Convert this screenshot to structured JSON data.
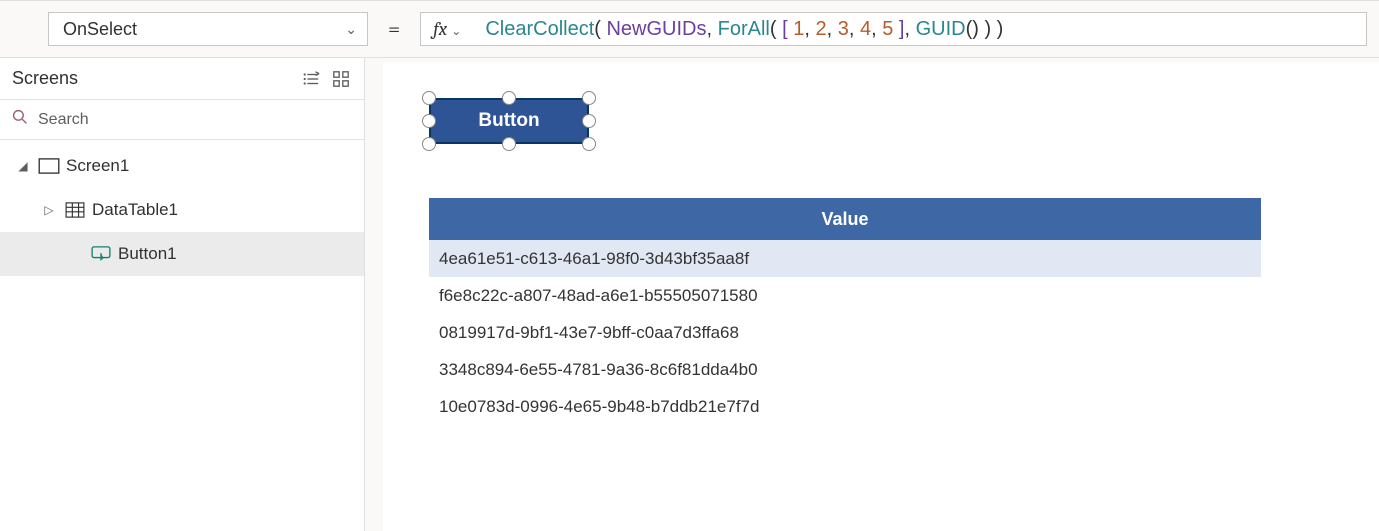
{
  "topbar": {
    "property": "OnSelect",
    "formula_tokens": [
      {
        "t": "ClearCollect",
        "c": "t-func"
      },
      {
        "t": "( ",
        "c": "t-punct"
      },
      {
        "t": "NewGUIDs",
        "c": "t-ident"
      },
      {
        "t": ", ",
        "c": "t-punct"
      },
      {
        "t": "ForAll",
        "c": "t-func"
      },
      {
        "t": "( ",
        "c": "t-punct"
      },
      {
        "t": "[ ",
        "c": "t-bracket"
      },
      {
        "t": "1",
        "c": "t-num"
      },
      {
        "t": ", ",
        "c": "t-punct"
      },
      {
        "t": "2",
        "c": "t-num"
      },
      {
        "t": ", ",
        "c": "t-punct"
      },
      {
        "t": "3",
        "c": "t-num"
      },
      {
        "t": ", ",
        "c": "t-punct"
      },
      {
        "t": "4",
        "c": "t-num"
      },
      {
        "t": ", ",
        "c": "t-punct"
      },
      {
        "t": "5",
        "c": "t-num"
      },
      {
        "t": " ]",
        "c": "t-bracket"
      },
      {
        "t": ", ",
        "c": "t-punct"
      },
      {
        "t": "GUID",
        "c": "t-func"
      },
      {
        "t": "() ) )",
        "c": "t-punct"
      }
    ]
  },
  "panel": {
    "title": "Screens",
    "search_placeholder": "Search",
    "tree": {
      "screen": "Screen1",
      "datatable": "DataTable1",
      "button": "Button1"
    }
  },
  "canvas": {
    "button_text": "Button",
    "table": {
      "header": "Value",
      "rows": [
        "4ea61e51-c613-46a1-98f0-3d43bf35aa8f",
        "f6e8c22c-a807-48ad-a6e1-b55505071580",
        "0819917d-9bf1-43e7-9bff-c0aa7d3ffa68",
        "3348c894-6e55-4781-9a36-8c6f81dda4b0",
        "10e0783d-0996-4e65-9b48-b7ddb21e7f7d"
      ]
    }
  }
}
